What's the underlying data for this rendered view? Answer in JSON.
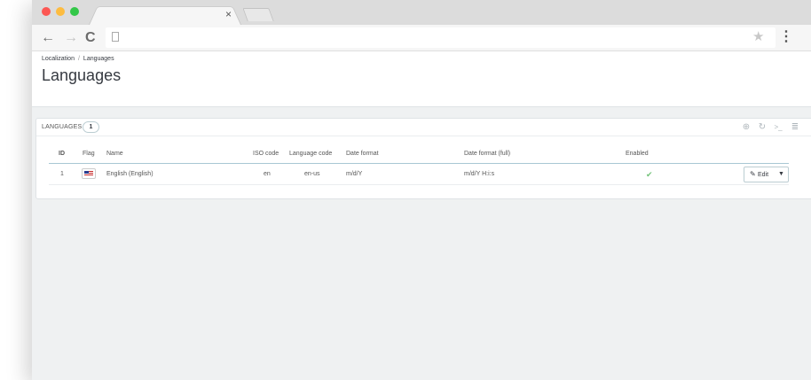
{
  "browser": {
    "tab_close_glyph": "×",
    "back_glyph": "←",
    "forward_glyph": "→",
    "reload_glyph": "C",
    "star_glyph": "★",
    "menu_glyph": "⋮",
    "traffic_lights": {
      "close": "#fc5753",
      "minimize": "#fdbc40",
      "maximize": "#33c748"
    }
  },
  "breadcrumb": {
    "parent": "Localization",
    "separator": "/",
    "current": "Languages"
  },
  "page": {
    "title": "Languages"
  },
  "panel": {
    "title": "LANGUAGES",
    "count": "1",
    "tools": {
      "add_glyph": "⊕",
      "refresh_glyph": "↻",
      "sql_glyph": ">_",
      "export_glyph": "≣"
    }
  },
  "table": {
    "headers": {
      "id": "ID",
      "flag": "Flag",
      "name": "Name",
      "iso": "ISO code",
      "lang_code": "Language code",
      "date_format": "Date format",
      "date_full": "Date format (full)",
      "enabled": "Enabled"
    },
    "rows": [
      {
        "id": "1",
        "flag": "us-flag",
        "name": "English (English)",
        "iso": "en",
        "lang_code": "en-us",
        "date_format": "m/d/Y",
        "date_full": "m/d/Y H:i:s",
        "enabled_glyph": "✔",
        "edit_label": "Edit",
        "edit_icon": "✎",
        "caret": "▼"
      }
    ]
  },
  "colors": {
    "accent": "#25b9d7",
    "enabled_check": "#72c279",
    "page_bg": "#eff1f2"
  }
}
